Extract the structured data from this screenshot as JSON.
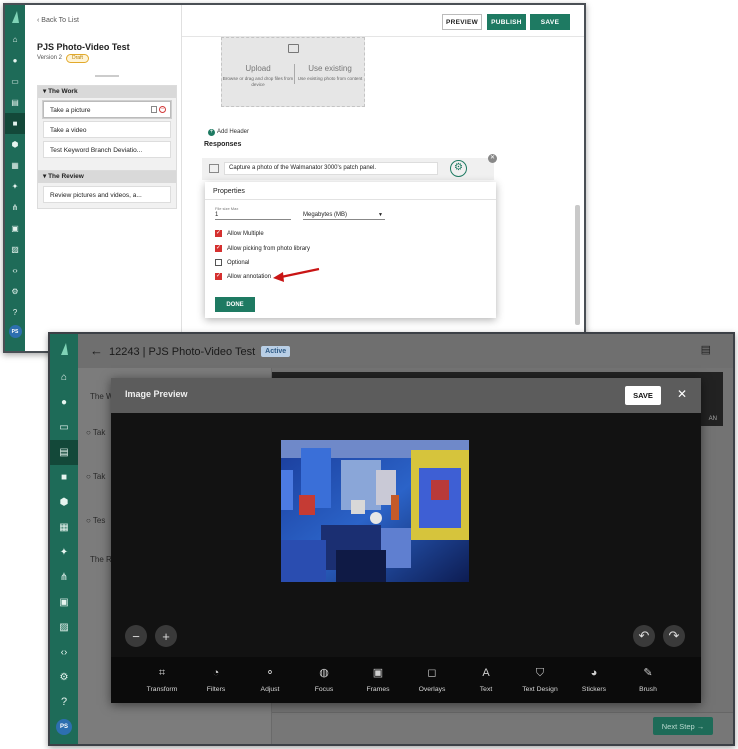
{
  "editor": {
    "back_label": "Back To List",
    "project_title": "PJS Photo-Video Test",
    "version": "Version 2",
    "draft_badge": "Draft",
    "toolbar": {
      "preview": "PREVIEW",
      "publish": "PUBLISH",
      "save": "SAVE"
    },
    "sections": [
      {
        "title": "The Work",
        "steps": [
          "Take a picture",
          "Take a video",
          "Test Keyword Branch Deviatio..."
        ]
      },
      {
        "title": "The Review",
        "steps": [
          "Review pictures and videos, a..."
        ]
      }
    ],
    "upload": {
      "title": "Upload",
      "desc": "Browse or drag and drop files from device"
    },
    "use_existing": {
      "title": "Use existing",
      "desc": "Use existing photo from content"
    },
    "add_header": "Add Header",
    "responses_label": "Responses",
    "response_text": "Capture a photo of the Walmanator 3000's patch panel.",
    "properties": {
      "title": "Properties",
      "file_size_label": "File size Max",
      "file_size_value": "1",
      "file_size_unit": "Megabytes (MB)",
      "options": [
        {
          "label": "Allow Multiple",
          "checked": true
        },
        {
          "label": "Allow picking from photo library",
          "checked": true
        },
        {
          "label": "Optional",
          "checked": false
        },
        {
          "label": "Allow annotation",
          "checked": true
        }
      ],
      "done_label": "DONE"
    },
    "avatar": "PS"
  },
  "preview": {
    "header_title": "12243 | PJS Photo-Video Test",
    "status_badge": "Active",
    "bg_items": [
      "The W",
      "Tak",
      "Tak",
      "Tes",
      "The R"
    ],
    "bg_fragment": "AN",
    "next_step": "Next Step",
    "modal": {
      "title": "Image Preview",
      "save_label": "SAVE",
      "close_label": "✕"
    },
    "tools": [
      "Transform",
      "Filters",
      "Adjust",
      "Focus",
      "Frames",
      "Overlays",
      "Text",
      "Text Design",
      "Stickers",
      "Brush"
    ],
    "avatar": "PS"
  },
  "colors": {
    "brand": "#1e6b58",
    "accent": "#1e7a62",
    "check": "#d5302f",
    "annotation_arrow": "#c91515"
  }
}
